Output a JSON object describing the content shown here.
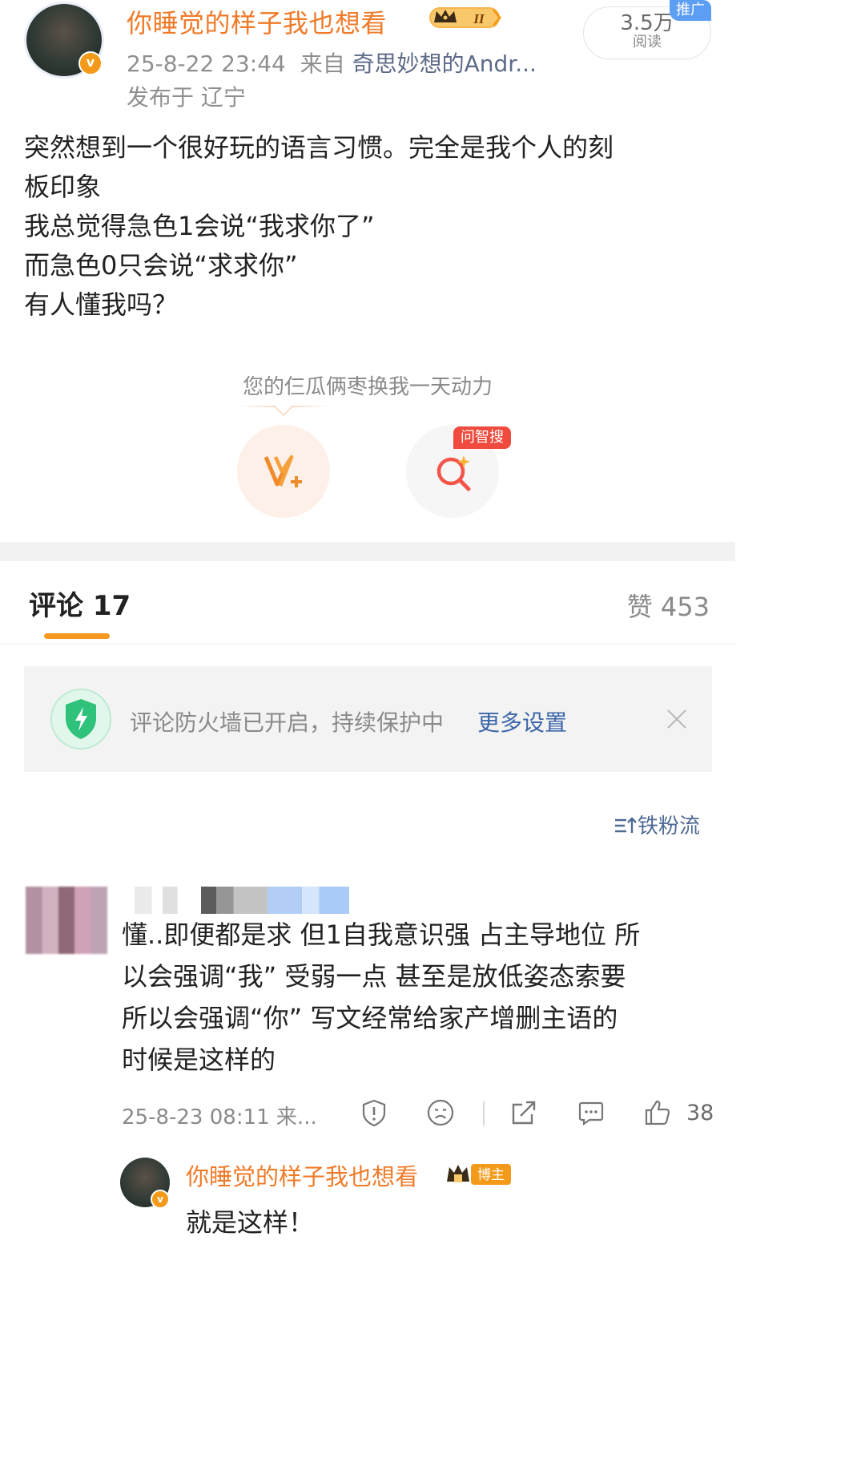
{
  "post": {
    "author": "你睡觉的样子我也想看",
    "level_badge": "II",
    "time": "25-8-22 23:44",
    "from_label": "来自",
    "source": "奇思妙想的Andr...",
    "location": "发布于 辽宁",
    "reads_count": "3.5万",
    "reads_label": "阅读",
    "promo_label": "推广",
    "lines": [
      "突然想到一个很好玩的语言习惯。完全是我个人的刻",
      "板印象",
      "我总觉得急色1会说“我求你了”",
      "而急色0只会说“求求你”",
      "有人懂我吗？"
    ],
    "slogan": "您的仨瓜俩枣换我一天动力",
    "search_tag": "问智搜"
  },
  "comments_header": {
    "tab_label": "评论 17",
    "likes_label": "赞 453"
  },
  "firewall": {
    "text": "评论防火墙已开启，持续保护中",
    "link": "更多设置"
  },
  "sort": {
    "label": "铁粉流"
  },
  "comment": {
    "lines": [
      "懂..即便都是求 但1自我意识强 占主导地位 所",
      "以会强调“我” 受弱一点 甚至是放低姿态索要",
      "所以会强调“你” 写文经常给家产增删主语的",
      "时候是这样的"
    ],
    "time": "25-8-23 08:11 来...",
    "likes": "38"
  },
  "reply": {
    "author": "你睡觉的样子我也想看",
    "badge": "博主",
    "text": "就是这样！"
  },
  "colors": {
    "username": "#f07a28",
    "link": "#3c66a8",
    "accent": "#f59a1f"
  }
}
